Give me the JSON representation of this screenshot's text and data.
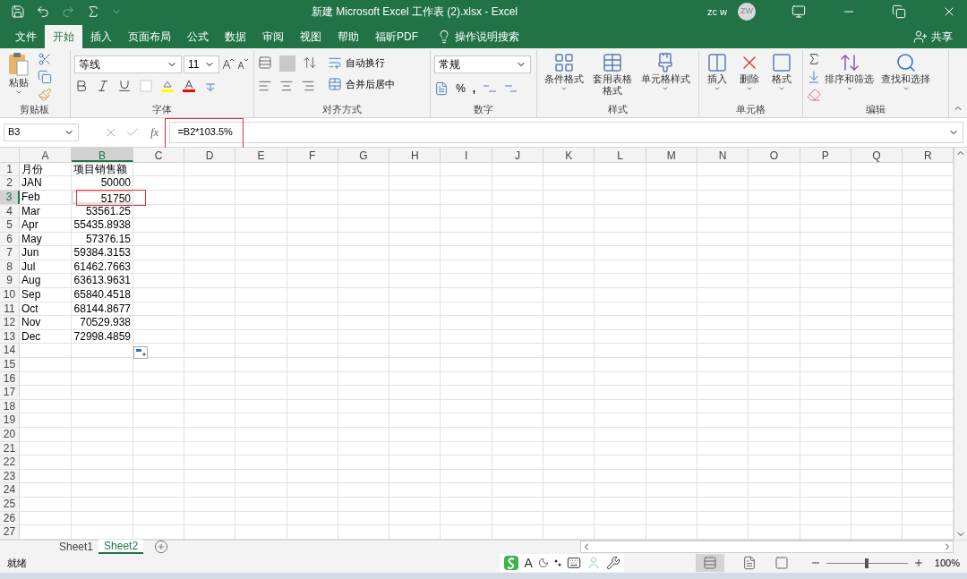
{
  "title_bar": {
    "title": "新建 Microsoft Excel 工作表 (2).xlsx  -  Excel",
    "user": "zc w",
    "avatar": "ZW"
  },
  "ribbon_tabs": [
    {
      "label": "文件",
      "selected": false
    },
    {
      "label": "开始",
      "selected": true
    },
    {
      "label": "插入",
      "selected": false
    },
    {
      "label": "页面布局",
      "selected": false
    },
    {
      "label": "公式",
      "selected": false
    },
    {
      "label": "数据",
      "selected": false
    },
    {
      "label": "审阅",
      "selected": false
    },
    {
      "label": "视图",
      "selected": false
    },
    {
      "label": "帮助",
      "selected": false
    },
    {
      "label": "福昕PDF",
      "selected": false
    }
  ],
  "tell_me": "操作说明搜索",
  "share": "共享",
  "ribbon": {
    "clipboard": {
      "paste": "粘贴",
      "label": "剪贴板"
    },
    "font": {
      "name": "等线",
      "size": "11",
      "label": "字体"
    },
    "alignment": {
      "wrap": "自动换行",
      "merge": "合并后居中",
      "label": "对齐方式"
    },
    "number": {
      "format": "常规",
      "percent": "%",
      "comma": ",",
      "label": "数字"
    },
    "styles": {
      "buttons": [
        "条件格式",
        "套用表格格式",
        "单元格样式"
      ],
      "label": "样式"
    },
    "cells": {
      "buttons": [
        "插入",
        "删除",
        "格式"
      ],
      "label": "单元格"
    },
    "editing": {
      "buttons": [
        "排序和筛选",
        "查找和选择"
      ],
      "label": "编辑"
    }
  },
  "formula_bar": {
    "name_box": "B3",
    "fx": "fx",
    "formula": "=B2*103.5%"
  },
  "columns": [
    {
      "label": "A",
      "selected": false
    },
    {
      "label": "B",
      "selected": true
    },
    {
      "label": "C",
      "selected": false
    },
    {
      "label": "D",
      "selected": false
    },
    {
      "label": "E",
      "selected": false
    },
    {
      "label": "F",
      "selected": false
    },
    {
      "label": "G",
      "selected": false
    },
    {
      "label": "H",
      "selected": false
    },
    {
      "label": "I",
      "selected": false
    },
    {
      "label": "J",
      "selected": false
    },
    {
      "label": "K",
      "selected": false
    },
    {
      "label": "L",
      "selected": false
    },
    {
      "label": "M",
      "selected": false
    },
    {
      "label": "N",
      "selected": false
    },
    {
      "label": "O",
      "selected": false
    },
    {
      "label": "P",
      "selected": false
    },
    {
      "label": "Q",
      "selected": false
    },
    {
      "label": "R",
      "selected": false
    }
  ],
  "rows": [
    {
      "number": "1",
      "selected": false,
      "cells": [
        {
          "kind": "text",
          "value": "月份"
        },
        {
          "kind": "text",
          "value": "项目销售额"
        }
      ]
    },
    {
      "number": "2",
      "selected": false,
      "cells": [
        {
          "kind": "text",
          "value": "JAN"
        },
        {
          "kind": "number",
          "value": "50000"
        }
      ]
    },
    {
      "number": "3",
      "selected": true,
      "cells": [
        {
          "kind": "text",
          "value": "Feb"
        },
        {
          "kind": "number",
          "value": "51750",
          "active": true
        }
      ]
    },
    {
      "number": "4",
      "selected": false,
      "cells": [
        {
          "kind": "text",
          "value": "Mar"
        },
        {
          "kind": "number",
          "value": "53561.25"
        }
      ]
    },
    {
      "number": "5",
      "selected": false,
      "cells": [
        {
          "kind": "text",
          "value": "Apr"
        },
        {
          "kind": "number",
          "value": "55435.8938"
        }
      ]
    },
    {
      "number": "6",
      "selected": false,
      "cells": [
        {
          "kind": "text",
          "value": "May"
        },
        {
          "kind": "number",
          "value": "57376.15"
        }
      ]
    },
    {
      "number": "7",
      "selected": false,
      "cells": [
        {
          "kind": "text",
          "value": "Jun"
        },
        {
          "kind": "number",
          "value": "59384.3153"
        }
      ]
    },
    {
      "number": "8",
      "selected": false,
      "cells": [
        {
          "kind": "text",
          "value": "Jul"
        },
        {
          "kind": "number",
          "value": "61462.7663"
        }
      ]
    },
    {
      "number": "9",
      "selected": false,
      "cells": [
        {
          "kind": "text",
          "value": "Aug"
        },
        {
          "kind": "number",
          "value": "63613.9631"
        }
      ]
    },
    {
      "number": "10",
      "selected": false,
      "cells": [
        {
          "kind": "text",
          "value": "Sep"
        },
        {
          "kind": "number",
          "value": "65840.4518"
        }
      ]
    },
    {
      "number": "11",
      "selected": false,
      "cells": [
        {
          "kind": "text",
          "value": "Oct"
        },
        {
          "kind": "number",
          "value": "68144.8677"
        }
      ]
    },
    {
      "number": "12",
      "selected": false,
      "cells": [
        {
          "kind": "text",
          "value": "Nov"
        },
        {
          "kind": "number",
          "value": "70529.938"
        }
      ]
    },
    {
      "number": "13",
      "selected": false,
      "cells": [
        {
          "kind": "text",
          "value": "Dec"
        },
        {
          "kind": "number",
          "value": "72998.4859"
        }
      ]
    },
    {
      "number": "14",
      "selected": false,
      "cells": []
    },
    {
      "number": "15",
      "selected": false,
      "cells": []
    },
    {
      "number": "16",
      "selected": false,
      "cells": []
    },
    {
      "number": "17",
      "selected": false,
      "cells": []
    },
    {
      "number": "18",
      "selected": false,
      "cells": []
    },
    {
      "number": "19",
      "selected": false,
      "cells": []
    },
    {
      "number": "20",
      "selected": false,
      "cells": []
    },
    {
      "number": "21",
      "selected": false,
      "cells": []
    },
    {
      "number": "22",
      "selected": false,
      "cells": []
    },
    {
      "number": "23",
      "selected": false,
      "cells": []
    },
    {
      "number": "24",
      "selected": false,
      "cells": []
    },
    {
      "number": "25",
      "selected": false,
      "cells": []
    },
    {
      "number": "26",
      "selected": false,
      "cells": []
    },
    {
      "number": "27",
      "selected": false,
      "cells": []
    }
  ],
  "sheet_tabs": [
    {
      "label": "Sheet1",
      "selected": false
    },
    {
      "label": "Sheet2",
      "selected": true
    }
  ],
  "status_bar": {
    "status": "就绪",
    "ime_letter": "A",
    "zoom": "100%",
    "zoom_slider": {
      "level": 0.5
    }
  }
}
